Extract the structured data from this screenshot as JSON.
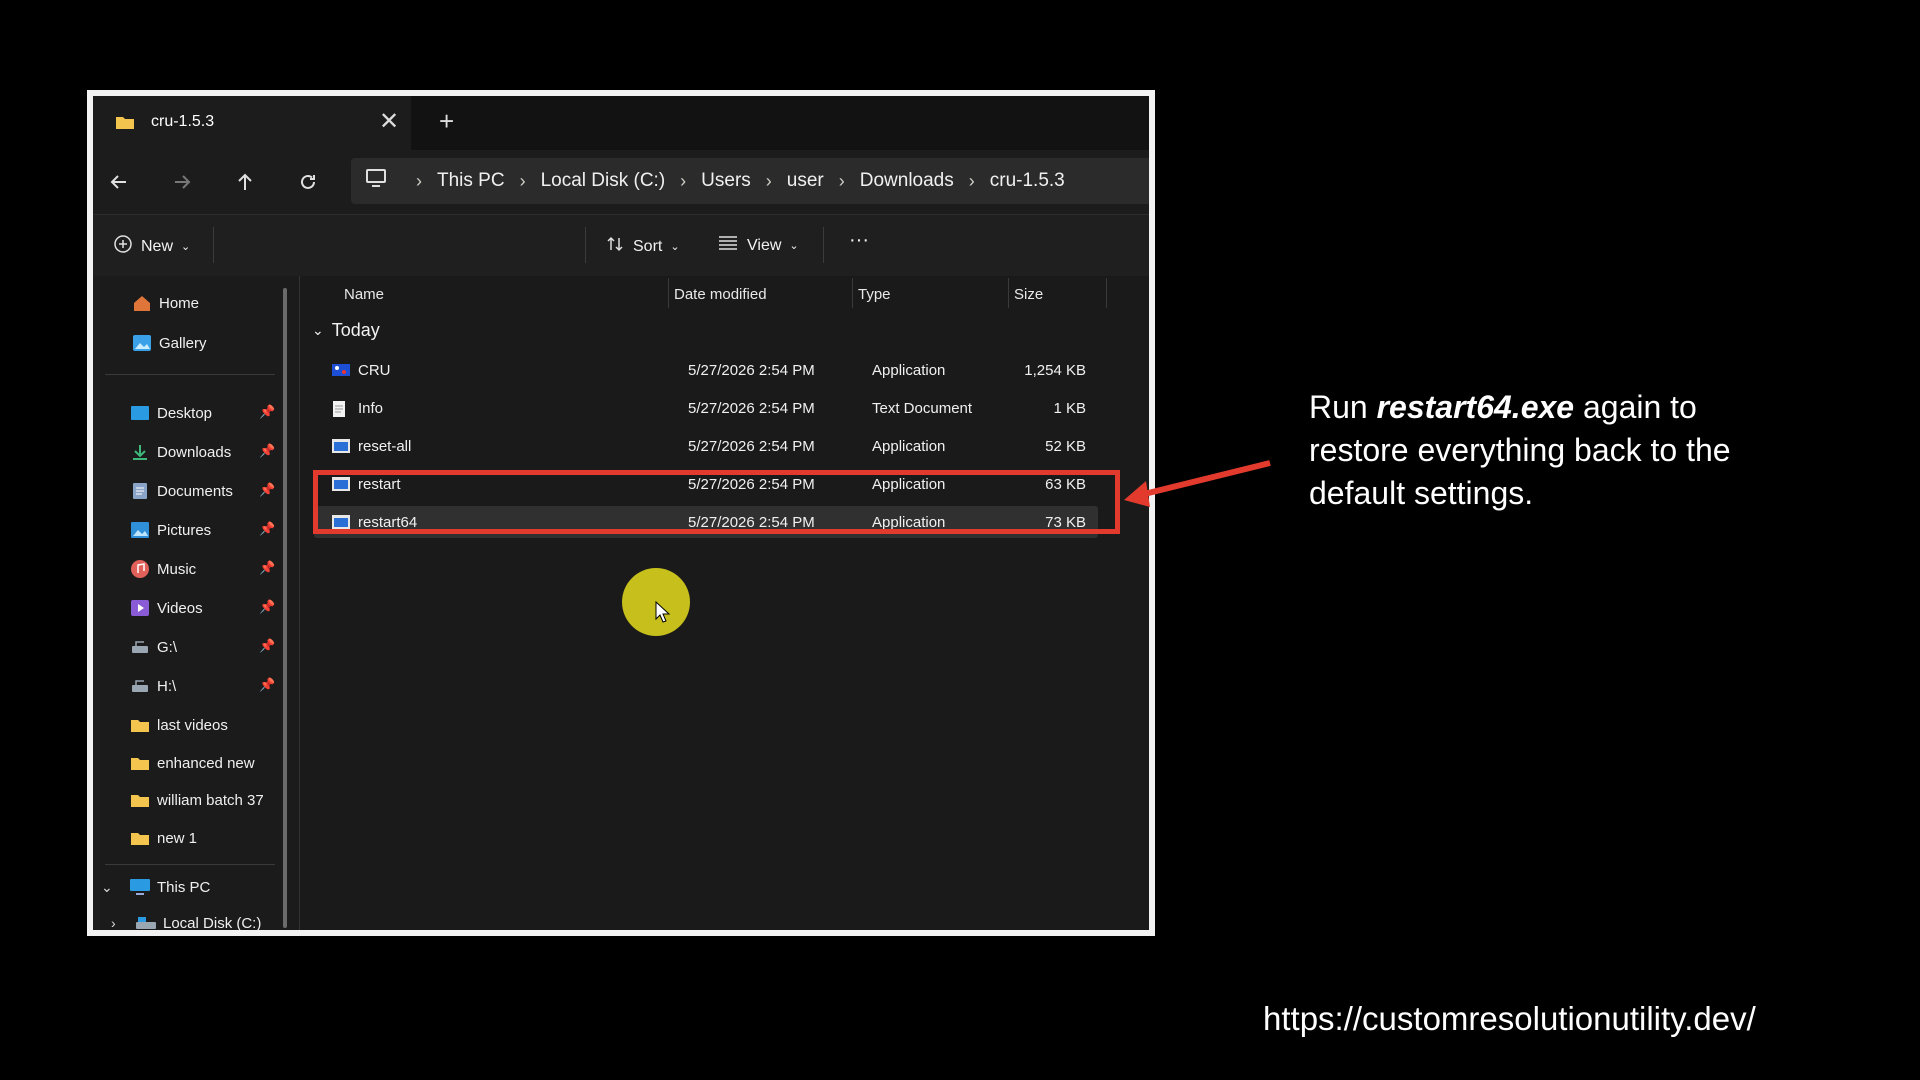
{
  "tab": {
    "title": "cru-1.5.3",
    "close_label": "✕",
    "new_tab_label": "+"
  },
  "breadcrumb": [
    "This PC",
    "Local Disk (C:)",
    "Users",
    "user",
    "Downloads",
    "cru-1.5.3"
  ],
  "commands": {
    "new": "New",
    "sort": "Sort",
    "view": "View",
    "more": "···"
  },
  "sidebar": {
    "quick": [
      "Home",
      "Gallery"
    ],
    "pinned": [
      "Desktop",
      "Downloads",
      "Documents",
      "Pictures",
      "Music",
      "Videos",
      "G:\\",
      "H:\\"
    ],
    "folders": [
      "last videos",
      "enhanced new",
      "william batch 37",
      "new 1"
    ],
    "this_pc": "This PC",
    "local_disk": "Local Disk (C:)"
  },
  "columns": {
    "name": "Name",
    "date": "Date modified",
    "type": "Type",
    "size": "Size"
  },
  "group": "Today",
  "files": [
    {
      "name": "CRU",
      "date": "5/27/2026 2:54 PM",
      "type": "Application",
      "size": "1,254 KB"
    },
    {
      "name": "Info",
      "date": "5/27/2026 2:54 PM",
      "type": "Text Document",
      "size": "1 KB"
    },
    {
      "name": "reset-all",
      "date": "5/27/2026 2:54 PM",
      "type": "Application",
      "size": "52 KB"
    },
    {
      "name": "restart",
      "date": "5/27/2026 2:54 PM",
      "type": "Application",
      "size": "63 KB"
    },
    {
      "name": "restart64",
      "date": "5/27/2026 2:54 PM",
      "type": "Application",
      "size": "73 KB"
    }
  ],
  "annotation": {
    "pre": "Run ",
    "bold": "restart64.exe",
    "post": " again to restore everything back to the default settings."
  },
  "url": "https://customresolutionutility.dev/",
  "colors": {
    "highlight": "#e23b2e",
    "cursor": "#c6bf1c"
  }
}
